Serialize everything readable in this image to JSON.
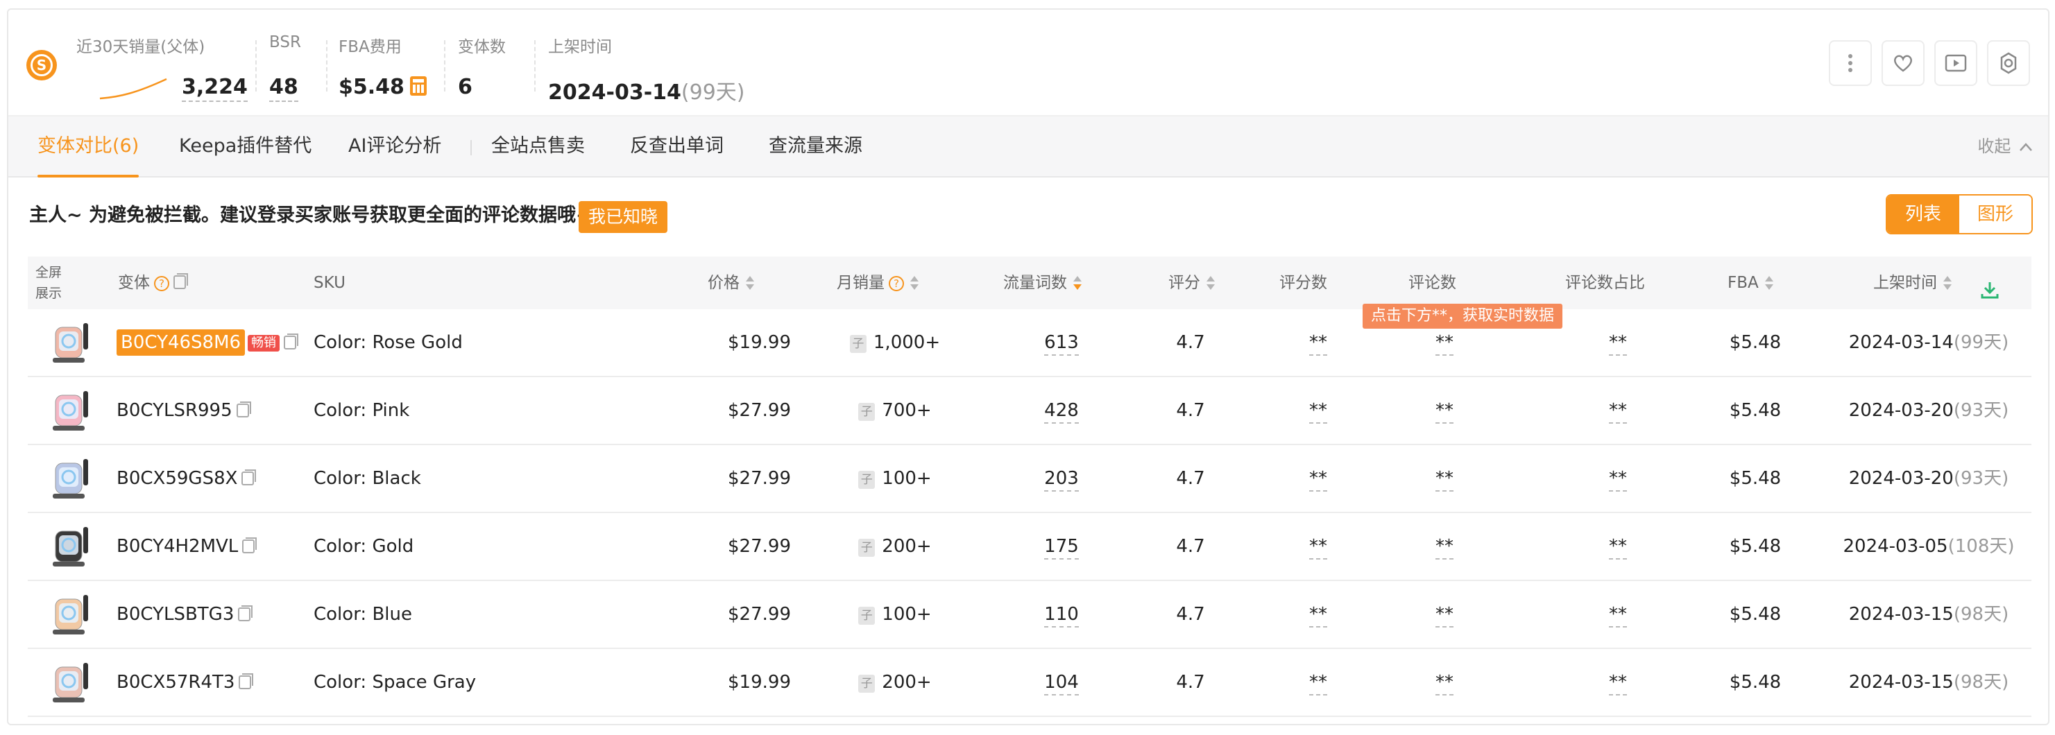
{
  "header": {
    "sales_label": "近30天销量(父体)",
    "sales_value": "3,224",
    "bsr_label": "BSR",
    "bsr_value": "48",
    "fba_label": "FBA费用",
    "fba_value": "$5.48",
    "variants_label": "变体数",
    "variants_value": "6",
    "listed_label": "上架时间",
    "listed_value": "2024-03-14",
    "listed_days": "(99天)"
  },
  "tabs": [
    {
      "label": "变体对比(6)"
    },
    {
      "label": "Keepa插件替代"
    },
    {
      "label": "AI评论分析"
    },
    {
      "label": "全站点售卖"
    },
    {
      "label": "反查出单词"
    },
    {
      "label": "查流量来源"
    }
  ],
  "collapse_label": "收起",
  "notice": {
    "text": "主人~ 为避免被拦截。建议登录买家账号获取更全面的评论数据哦~",
    "button": "我已知晓"
  },
  "view_toggle": {
    "list": "列表",
    "graph": "图形"
  },
  "table": {
    "headers": {
      "fullscreen_line1": "全屏",
      "fullscreen_line2": "展示",
      "variant": "变体",
      "sku": "SKU",
      "price": "价格",
      "monthly_sales": "月销量",
      "traffic_words": "流量词数",
      "rating": "评分",
      "rating_count": "评分数",
      "review_count": "评论数",
      "review_ratio": "评论数占比",
      "fba": "FBA",
      "listed": "上架时间"
    },
    "tooltip": "点击下方**，获取实时数据",
    "hot_badge": "畅销",
    "rows": [
      {
        "asin": "B0CY46S8M6",
        "sku": "Color: Rose Gold",
        "price": "$19.99",
        "sales": "1,000+",
        "words": "613",
        "rating": "4.7",
        "rating_count": "**",
        "review_count": "**",
        "review_ratio": "**",
        "fba": "$5.48",
        "date": "2024-03-14",
        "days": "(99天)",
        "color": "#f0b8a8"
      },
      {
        "asin": "B0CYLSR995",
        "sku": "Color: Pink",
        "price": "$27.99",
        "sales": "700+",
        "words": "428",
        "rating": "4.7",
        "rating_count": "**",
        "review_count": "**",
        "review_ratio": "**",
        "fba": "$5.48",
        "date": "2024-03-20",
        "days": "(93天)",
        "color": "#f5b7c5"
      },
      {
        "asin": "B0CX59GS8X",
        "sku": "Color: Black",
        "price": "$27.99",
        "sales": "100+",
        "words": "203",
        "rating": "4.7",
        "rating_count": "**",
        "review_count": "**",
        "review_ratio": "**",
        "fba": "$5.48",
        "date": "2024-03-20",
        "days": "(93天)",
        "color": "#b9c7e6"
      },
      {
        "asin": "B0CY4H2MVL",
        "sku": "Color: Gold",
        "price": "$27.99",
        "sales": "200+",
        "words": "175",
        "rating": "4.7",
        "rating_count": "**",
        "review_count": "**",
        "review_ratio": "**",
        "fba": "$5.48",
        "date": "2024-03-05",
        "days": "(108天)",
        "color": "#3a3a3a"
      },
      {
        "asin": "B0CYLSBTG3",
        "sku": "Color: Blue",
        "price": "$27.99",
        "sales": "100+",
        "words": "110",
        "rating": "4.7",
        "rating_count": "**",
        "review_count": "**",
        "review_ratio": "**",
        "fba": "$5.48",
        "date": "2024-03-15",
        "days": "(98天)",
        "color": "#f2c9a4"
      },
      {
        "asin": "B0CX57R4T3",
        "sku": "Color: Space Gray",
        "price": "$19.99",
        "sales": "200+",
        "words": "104",
        "rating": "4.7",
        "rating_count": "**",
        "review_count": "**",
        "review_ratio": "**",
        "fba": "$5.48",
        "date": "2024-03-15",
        "days": "(98天)",
        "color": "#eac0b4"
      }
    ]
  },
  "colors": {
    "accent": "#f7941d",
    "hot": "#f0504a",
    "tooltip": "#f58a5a",
    "download": "#2bb673"
  },
  "icons": {
    "logo": "seller-logo-icon",
    "calculator": "calculator-icon",
    "more": "more-vertical-icon",
    "favorite": "heart-icon",
    "video": "play-icon",
    "settings": "gear-icon",
    "download": "download-icon",
    "copy": "copy-icon",
    "help": "help-circle-icon"
  }
}
